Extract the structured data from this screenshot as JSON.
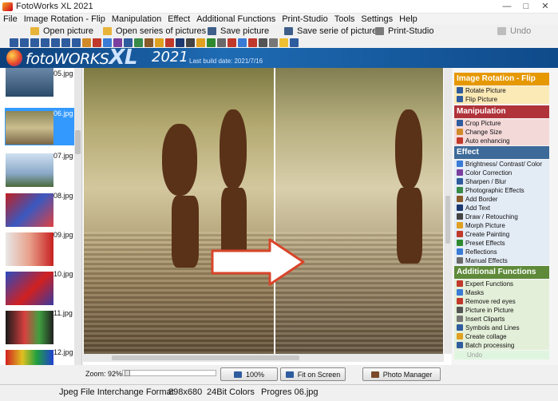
{
  "window": {
    "title": "FotoWorks XL 2021"
  },
  "menu": [
    "File",
    "Image Rotation - Flip",
    "Manipulation",
    "Effect",
    "Additional Functions",
    "Print-Studio",
    "Tools",
    "Settings",
    "Help"
  ],
  "actions": {
    "open_picture": "Open picture",
    "open_series": "Open series of pictures",
    "save_picture": "Save picture",
    "save_serie": "Save serie of pictures",
    "print_studio": "Print-Studio",
    "undo": "Undo"
  },
  "banner": {
    "brand": "fotoWORKS",
    "xl": "XL",
    "version": "2021",
    "build": "Last build date: 2021/7/16"
  },
  "thumbnails": [
    {
      "name": "05.jpg",
      "selected": false
    },
    {
      "name": "06.jpg",
      "selected": true
    },
    {
      "name": "07.jpg",
      "selected": false
    },
    {
      "name": "08.jpg",
      "selected": false
    },
    {
      "name": "09.jpg",
      "selected": false
    },
    {
      "name": "10.jpg",
      "selected": false
    },
    {
      "name": "11.jpg",
      "selected": false
    },
    {
      "name": "12.jpg",
      "selected": false
    }
  ],
  "panel": {
    "rotation": {
      "title": "Image Rotation - Flip",
      "color": "#e69800",
      "items": [
        "Rotate Picture",
        "Flip Picture"
      ]
    },
    "manipulation": {
      "title": "Manipulation",
      "color": "#b0333a",
      "items": [
        "Crop Picture",
        "Change Size",
        "Auto enhancing"
      ]
    },
    "effect": {
      "title": "Effect",
      "color": "#3d6a99",
      "items": [
        "Brightness/ Contrast/ Color",
        "Color Correction",
        "Sharpen / Blur",
        "Photographic Effects",
        "Add Border",
        "Add Text",
        "Draw / Retouching",
        "Morph Picture",
        "Create Painting",
        "Preset Effects",
        "Reflections",
        "Manual Effects"
      ]
    },
    "additional": {
      "title": "Additional Functions",
      "color": "#5e8a3a",
      "items": [
        "Expert Functions",
        "Masks",
        "Remove red eyes",
        "Picture in Picture",
        "Insert Cliparts",
        "Symbols and Lines",
        "Create collage",
        "Batch processing"
      ]
    },
    "undo": "Undo"
  },
  "bottom": {
    "zoom_label": "Zoom: 92%",
    "zoom_value": 0.92,
    "btn_100": "100%",
    "btn_fit": "Fit on Screen",
    "btn_manager": "Photo Manager"
  },
  "status": {
    "format": "Jpeg File Interchange Format",
    "dimensions": "898x680",
    "colors": "24Bit Colors",
    "progress": "Progres 06.jpg"
  }
}
